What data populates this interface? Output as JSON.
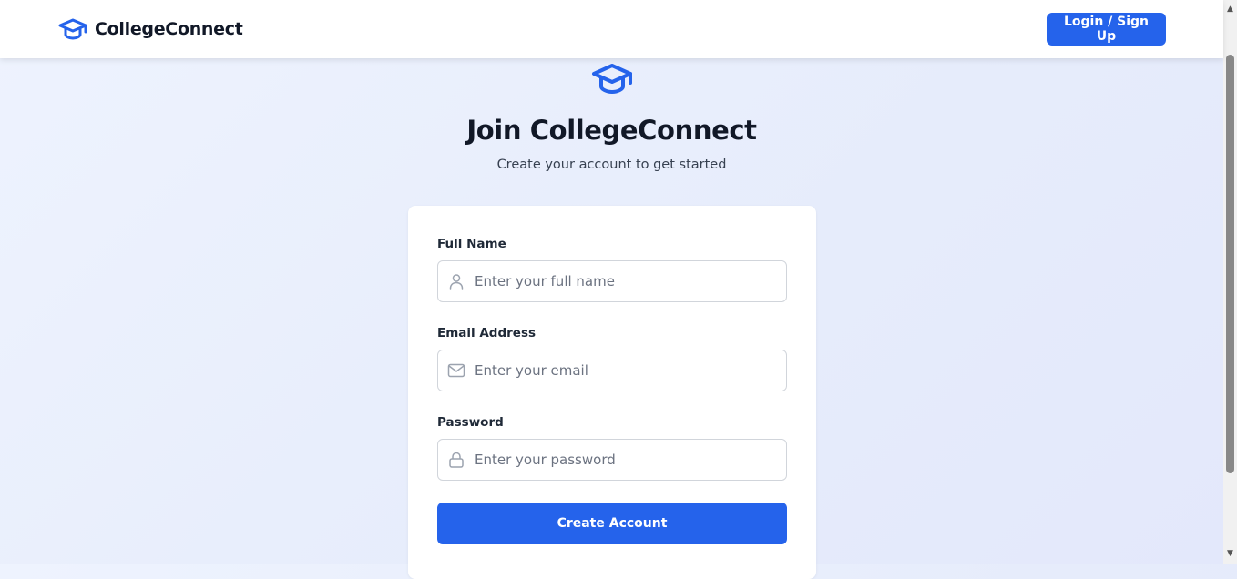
{
  "brand": {
    "name": "CollegeConnect",
    "icon": "graduation-cap-icon"
  },
  "nav": {
    "auth_button": "Login / Sign Up"
  },
  "hero": {
    "icon": "graduation-cap-icon",
    "title": "Join CollegeConnect",
    "subtitle": "Create your account to get started"
  },
  "form": {
    "full_name": {
      "label": "Full Name",
      "placeholder": "Enter your full name",
      "value": "",
      "icon": "user-icon"
    },
    "email": {
      "label": "Email Address",
      "placeholder": "Enter your email",
      "value": "",
      "icon": "mail-icon"
    },
    "password": {
      "label": "Password",
      "placeholder": "Enter your password",
      "value": "",
      "icon": "lock-icon"
    },
    "submit_label": "Create Account"
  },
  "colors": {
    "primary": "#2563eb",
    "text": "#111827",
    "muted": "#6b7280",
    "border": "#d1d5db"
  }
}
